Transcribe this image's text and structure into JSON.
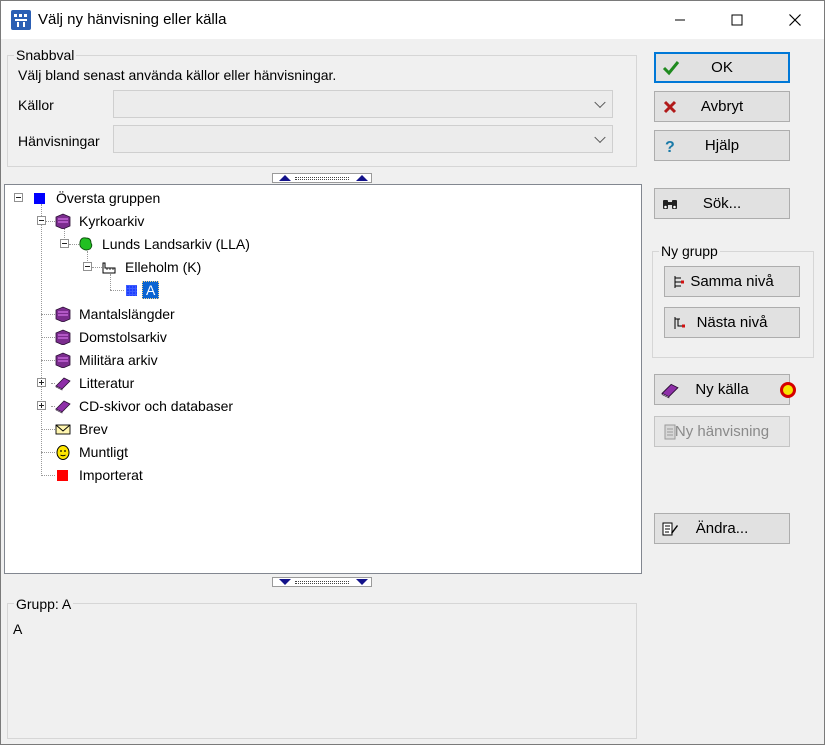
{
  "window": {
    "title": "Välj ny hänvisning eller källa",
    "controls": {
      "minimize": "—",
      "maximize": "☐",
      "close": "✕"
    }
  },
  "quick_select": {
    "legend": "Snabbval",
    "description": "Välj bland senast använda källor eller hänvisningar.",
    "sources_label": "Källor",
    "sources_value": "",
    "references_label": "Hänvisningar",
    "references_value": ""
  },
  "tree": {
    "nodes": [
      {
        "label": "Översta gruppen",
        "icon": "blue-square-icon"
      },
      {
        "label": "Kyrkoarkiv",
        "icon": "books-icon"
      },
      {
        "label": "Lunds Landsarkiv (LLA)",
        "icon": "green-archive-icon"
      },
      {
        "label": "Elleholm (K)",
        "icon": "pointing-hand-icon"
      },
      {
        "label": "A",
        "icon": "blue-grid-square-icon",
        "selected": true
      },
      {
        "label": "Mantalslängder",
        "icon": "books-icon"
      },
      {
        "label": "Domstolsarkiv",
        "icon": "books-icon"
      },
      {
        "label": "Militära arkiv",
        "icon": "books-icon"
      },
      {
        "label": "Litteratur",
        "icon": "book-icon"
      },
      {
        "label": "CD-skivor och databaser",
        "icon": "book-icon"
      },
      {
        "label": "Brev",
        "icon": "envelope-icon"
      },
      {
        "label": "Muntligt",
        "icon": "face-icon"
      },
      {
        "label": "Importerat",
        "icon": "red-square-icon"
      }
    ]
  },
  "info": {
    "legend": "Grupp: A",
    "value": "A"
  },
  "buttons": {
    "ok": "OK",
    "cancel": "Avbryt",
    "help": "Hjälp",
    "search": "Sök...",
    "new_group_legend": "Ny grupp",
    "same_level": "Samma nivå",
    "next_level": "Nästa nivå",
    "new_source": "Ny källa",
    "new_reference": "Ny hänvisning",
    "edit": "Ändra..."
  },
  "colors": {
    "accent": "#0078d7",
    "selection": "#0a64d2",
    "titlebar": "#ffffff",
    "dialog_bg": "#f0f0f0"
  }
}
